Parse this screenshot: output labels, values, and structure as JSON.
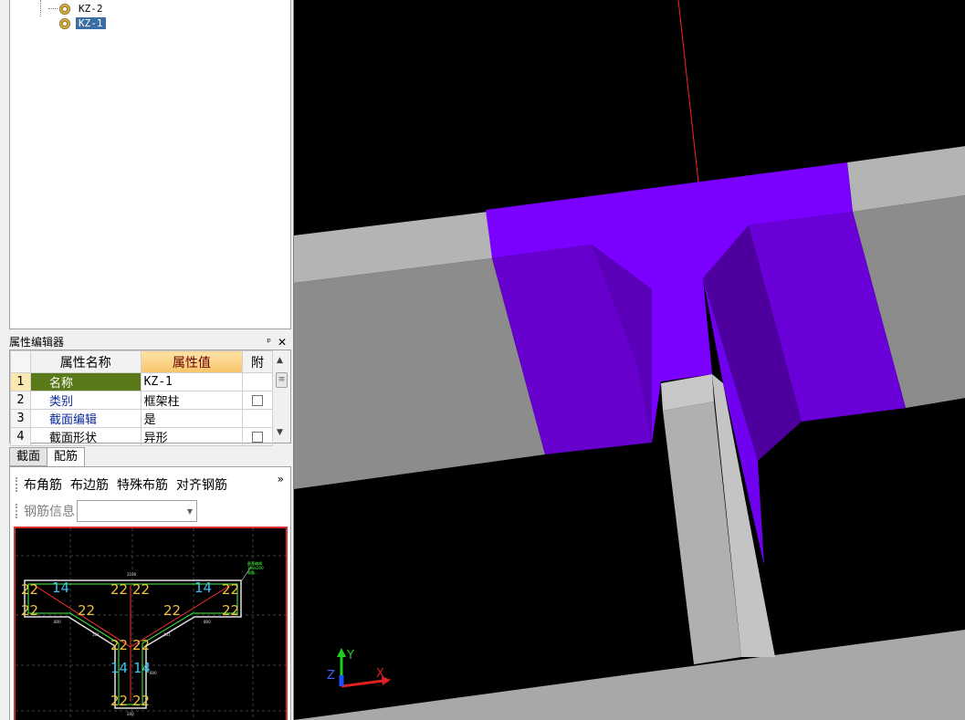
{
  "tree": {
    "items": [
      {
        "label": "KZ-2",
        "selected": false
      },
      {
        "label": "KZ-1",
        "selected": true
      }
    ]
  },
  "property_editor": {
    "title": "属性编辑器",
    "pin_glyph": "ᴘ",
    "close_glyph": "✕",
    "headers": {
      "name": "属性名称",
      "value": "属性值",
      "extra": "附"
    },
    "rows": [
      {
        "num": "1",
        "name": "名称",
        "value": "KZ-1",
        "checkbox": false
      },
      {
        "num": "2",
        "name": "类别",
        "value": "框架柱",
        "checkbox": true
      },
      {
        "num": "3",
        "name": "截面编辑",
        "value": "是",
        "checkbox": false
      },
      {
        "num": "4",
        "name": "截面形状",
        "value": "异形",
        "checkbox": true
      }
    ]
  },
  "tabs": [
    {
      "label": "截面",
      "active": false
    },
    {
      "label": "配筋",
      "active": true
    }
  ],
  "toolbar": {
    "buttons": [
      "布角筋",
      "布边筋",
      "特殊布筋",
      "对齐钢筋"
    ],
    "more": "»",
    "rebar_info_label": "钢筋信息",
    "rebar_info_value": ""
  },
  "section_drawing": {
    "dims": {
      "top": "2100",
      "left_w": "800",
      "right_w": "800",
      "web_w": "200",
      "diag_l": "101",
      "diag_r": "101",
      "web_h": "600"
    },
    "bar_labels": {
      "corner": "22",
      "edge": "14"
    },
    "legend": [
      "截面编辑",
      "100x200",
      "钢筋..."
    ]
  },
  "axes": {
    "x": "X",
    "y": "Y",
    "z": "Z"
  },
  "colors": {
    "column": "#7a00ff",
    "beam_top": "#b4b4b4",
    "beam_side": "#8c8c8c",
    "background": "#000000",
    "selection": "#3a6ea5",
    "cad_border": "#d83030"
  }
}
